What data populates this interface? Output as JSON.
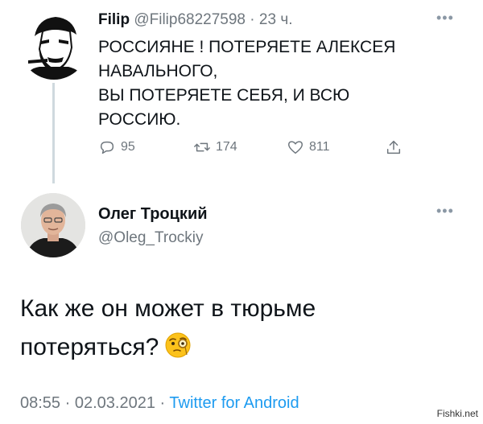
{
  "tweet1": {
    "name": "Filip",
    "handle": "@Filip68227598",
    "separator": "·",
    "time": "23 ч.",
    "more_icon": "more-horizontal-icon",
    "lines": [
      "РОССИЯНЕ ! ПОТЕРЯЕТЕ АЛЕКСЕЯ",
      "НАВАЛЬНОГО,",
      "ВЫ ПОТЕРЯЕТЕ СЕБЯ, И ВСЮ",
      "РОССИЮ."
    ],
    "replies": "95",
    "retweets": "174",
    "likes": "811"
  },
  "tweet2": {
    "name": "Олег Троцкий",
    "handle": "@Oleg_Trockiy",
    "more_icon": "more-horizontal-icon",
    "lines": [
      "Как же он может в тюрьме",
      "потеряться?"
    ],
    "emoji": "face-with-monocle-emoji",
    "time": "08:55",
    "date": "02.03.2021",
    "separator": "·",
    "source": "Twitter for Android"
  },
  "watermark": "Fishki.net",
  "colors": {
    "text": "#0f1419",
    "muted": "#6e767d",
    "link": "#1d9bf0",
    "thread_line": "#cfd9de"
  }
}
